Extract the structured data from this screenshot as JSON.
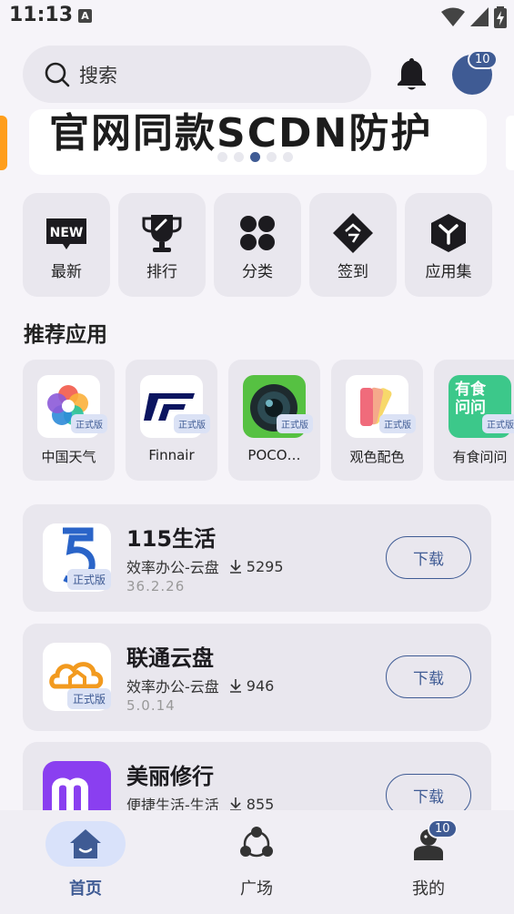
{
  "status_bar": {
    "time": "11:13",
    "notification_glyph": "A",
    "icons": [
      "wifi-icon",
      "signal-icon",
      "battery-charging-icon"
    ]
  },
  "header": {
    "search_placeholder": "搜索",
    "notification_icon": "bell-icon",
    "avatar_badge": "10"
  },
  "banner": {
    "text": "官网同款SCDN防护",
    "dot_count": 5,
    "active_dot_index": 2
  },
  "quick_actions": [
    {
      "label": "最新",
      "icon": "new-icon"
    },
    {
      "label": "排行",
      "icon": "trophy-icon"
    },
    {
      "label": "分类",
      "icon": "category-grid-icon"
    },
    {
      "label": "签到",
      "icon": "checkin-icon"
    },
    {
      "label": "应用集",
      "icon": "app-collection-icon"
    }
  ],
  "recommended": {
    "title": "推荐应用",
    "apps": [
      {
        "name": "中国天气",
        "badge": "正式版",
        "icon": "china-weather-icon"
      },
      {
        "name": "Finnair",
        "badge": "正式版",
        "icon": "finnair-icon"
      },
      {
        "name": "POCO…",
        "badge": "正式版",
        "icon": "poco-camera-icon"
      },
      {
        "name": "观色配色",
        "badge": "正式版",
        "icon": "color-palette-icon"
      },
      {
        "name": "有食问问",
        "badge": "正式版",
        "icon": "youshi-icon",
        "icon_text": "有食问问"
      }
    ]
  },
  "app_list": [
    {
      "name": "115生活",
      "category": "效率办公-云盘",
      "downloads": "5295",
      "version": "36.2.26",
      "badge": "正式版",
      "action": "下载",
      "icon": "115-life-icon"
    },
    {
      "name": "联通云盘",
      "category": "效率办公-云盘",
      "downloads": "946",
      "version": "5.0.14",
      "badge": "正式版",
      "action": "下载",
      "icon": "unicom-cloud-icon"
    },
    {
      "name": "美丽修行",
      "category": "便捷生活-生活",
      "downloads": "855",
      "version": "",
      "badge": "",
      "action": "下载",
      "icon": "meili-xiuxing-icon"
    }
  ],
  "bottom_nav": [
    {
      "label": "首页",
      "icon": "home-icon",
      "active": true
    },
    {
      "label": "广场",
      "icon": "community-icon",
      "active": false
    },
    {
      "label": "我的",
      "icon": "profile-icon",
      "active": false,
      "badge": "10"
    }
  ],
  "colors": {
    "accent": "#3f5b94",
    "background": "#f6f4f9",
    "card": "#e9e7ee",
    "badge_bg": "#dbe2f5"
  }
}
